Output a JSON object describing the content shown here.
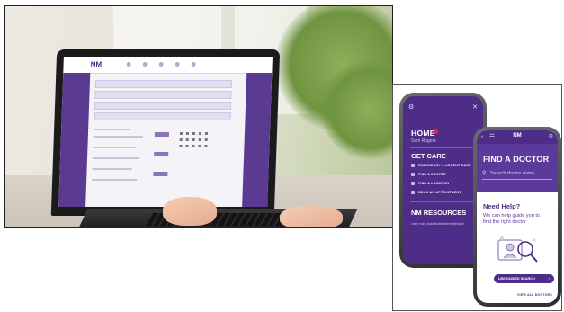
{
  "laptop": {
    "screen_logo": "NM",
    "window_light": "#f3f1ee",
    "brand_color": "#5b3a92"
  },
  "back_phone": {
    "top_icons": [
      "gear-icon",
      "close-icon"
    ],
    "home_label": "HOME",
    "user_name": "Sam Rogers",
    "get_care_label": "GET CARE",
    "care_items": [
      {
        "label": "EMERGENCY & URGENT CARE",
        "icon": "emergency-icon"
      },
      {
        "label": "FIND A DOCTOR",
        "icon": "doctor-icon"
      },
      {
        "label": "FIND A LOCATION",
        "icon": "location-icon"
      },
      {
        "label": "BOOK AN APPOINTMENT",
        "icon": "calendar-icon"
      }
    ],
    "resources_label": "NM RESOURCES",
    "resources_sub": "Learn more about Northwestern Medicine"
  },
  "front_phone": {
    "logo": "NM",
    "title": "FIND A DOCTOR",
    "search_placeholder": "Search doctor name",
    "help_title": "Need Help?",
    "help_body": "We can help guide you to find the right doctor",
    "guided_search_label": "USE GUIDED SEARCH",
    "view_all_label": "VIEW ALL DOCTORS",
    "brand_color": "#4e2d89"
  }
}
